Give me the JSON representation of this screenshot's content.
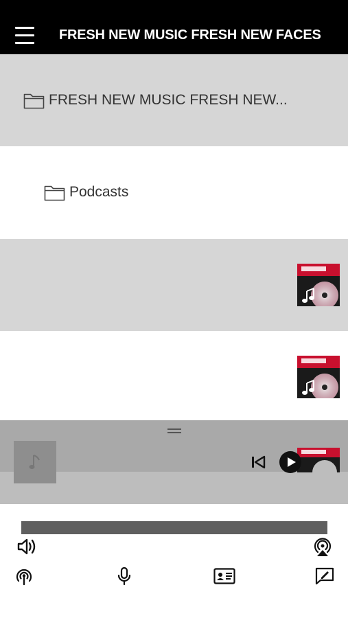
{
  "header": {
    "title": "FRESH NEW MUSIC FRESH NEW FACES"
  },
  "list": {
    "items": [
      {
        "label": "FRESH NEW MUSIC FRESH NEW...",
        "icon": "folder-icon"
      },
      {
        "label": "Podcasts",
        "icon": "folder-icon"
      },
      {
        "label": "",
        "thumbnail": "album-art"
      },
      {
        "label": "",
        "thumbnail": "album-art"
      }
    ]
  },
  "player": {
    "artwork_icon": "music-note-icon",
    "controls": [
      "previous-track-icon",
      "play-icon"
    ],
    "progress": 0
  },
  "toolbar": {
    "icons": [
      "volume-icon",
      "airplay-icon",
      "podcast-icon",
      "microphone-icon",
      "contact-card-icon",
      "compose-icon"
    ]
  },
  "colors": {
    "header_bg": "#000000",
    "row_grey": "#d6d6d6",
    "player_bg": "#a9a9a9",
    "progress_bar": "#5f5f5f"
  }
}
